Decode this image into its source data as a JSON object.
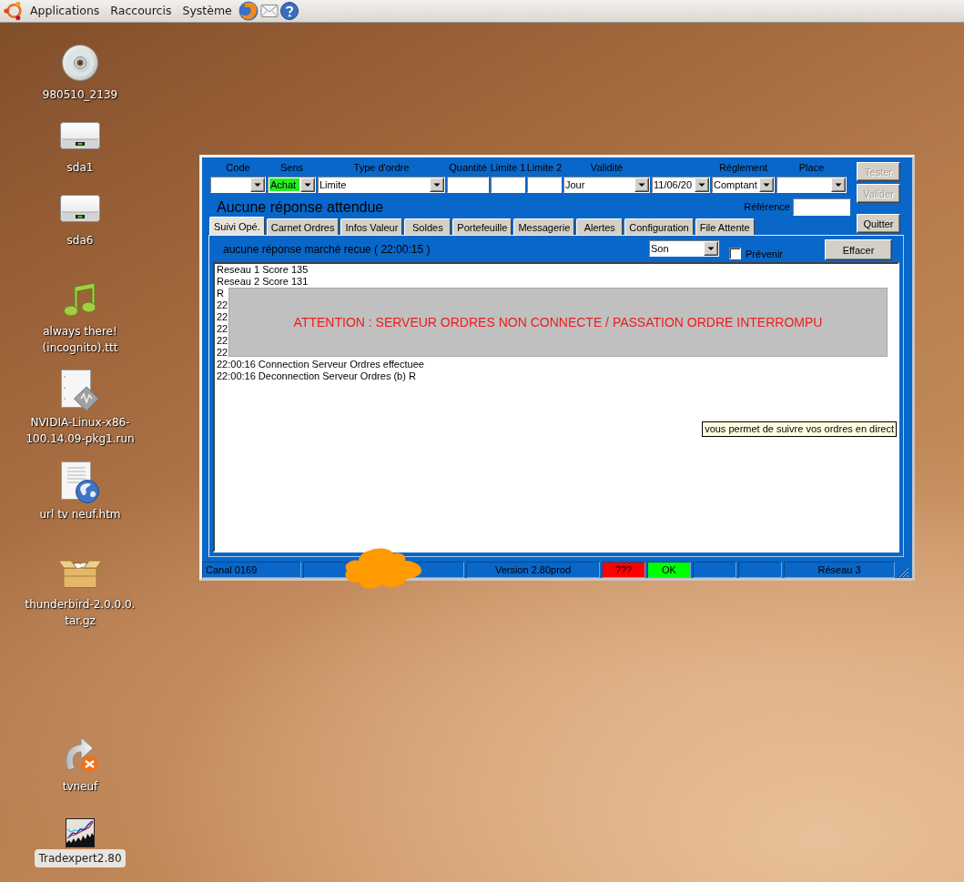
{
  "top_panel": {
    "menus": [
      {
        "label": "Applications"
      },
      {
        "label": "Raccourcis"
      },
      {
        "label": "Système"
      }
    ]
  },
  "desktop_icons": [
    {
      "kind": "disc",
      "label": "980510_2139",
      "selected": false
    },
    {
      "kind": "drive",
      "label": "sda1",
      "selected": false
    },
    {
      "kind": "drive",
      "label": "sda6",
      "selected": false
    },
    {
      "kind": "audio",
      "label": "always there!\n(incognito).ttt",
      "selected": false
    },
    {
      "kind": "binary",
      "label": "NVIDIA-Linux-x86-\n100.14.09-pkg1.run",
      "selected": false
    },
    {
      "kind": "web",
      "label": "url tv neuf.htm",
      "selected": false
    },
    {
      "kind": "archive",
      "label": "thunderbird-2.0.0.0.\ntar.gz",
      "selected": false
    },
    {
      "kind": "link",
      "label": "tvneuf",
      "selected": false
    },
    {
      "kind": "app",
      "label": "Tradexpert2.80",
      "selected": true
    }
  ],
  "window": {
    "order_form": [
      {
        "kind": "combo",
        "label": "Code",
        "highlighted": false
      },
      {
        "kind": "combo",
        "label": "Sens",
        "value": "Achat",
        "highlighted": true
      },
      {
        "kind": "combo",
        "label": "Type d'ordre",
        "value": "Limite",
        "highlighted": false
      },
      {
        "kind": "input",
        "label": "Quantité",
        "highlighted": false
      },
      {
        "kind": "input",
        "label": "Limite 1",
        "highlighted": false
      },
      {
        "kind": "input",
        "label": "Limite 2",
        "highlighted": false
      },
      {
        "kind": "combo",
        "label": "Validité",
        "value": "Jour",
        "highlighted": false
      },
      {
        "kind": "combo",
        "value": "11/06/20",
        "highlighted": false
      },
      {
        "kind": "combo",
        "label": "Réglement",
        "value": "Comptant",
        "highlighted": false
      },
      {
        "kind": "combo",
        "label": "Place",
        "highlighted": false
      }
    ],
    "buttons": [
      {
        "label": "Tester",
        "disabled": true
      },
      {
        "label": "Valider",
        "disabled": true
      },
      {
        "label": "Quitter",
        "disabled": false
      }
    ],
    "response_status": "Aucune réponse attendue",
    "reference": {
      "label": "Référence"
    },
    "tabs": [
      {
        "label": "Suivi Opé.",
        "selected": true
      },
      {
        "label": "Carnet Ordres",
        "selected": false
      },
      {
        "label": "Infos Valeur",
        "selected": false
      },
      {
        "label": "Soldes",
        "selected": false
      },
      {
        "label": "Portefeuille",
        "selected": false
      },
      {
        "label": "Messagerie",
        "selected": false
      },
      {
        "label": "Alertes",
        "selected": false
      },
      {
        "label": "Configuration",
        "selected": false
      },
      {
        "label": "File Attente",
        "selected": false
      }
    ],
    "panel": {
      "market_status": "aucune réponse marché recue ( 22:00:15 )",
      "sound_select": {
        "value": "Son"
      },
      "notify": {
        "label": "Prévenir",
        "checked": false
      },
      "clear_button": {
        "label": "Effacer"
      },
      "log": [
        "Reseau 1 Score 135",
        "Reseau 2 Score 131",
        "R",
        "22",
        "22",
        "22",
        "22",
        "22",
        "22:00:16 Connection Serveur Ordres effectuee",
        "22:00:16 Deconnection Serveur Ordres (b) R"
      ],
      "alert": "ATTENTION : SERVEUR ORDRES NON CONNECTE / PASSATION ORDRE INTERROMPU",
      "tooltip": "vous permet de suivre vos ordres en direct"
    },
    "status_bar": [
      {
        "kind": "text",
        "text": "Canal 0169"
      },
      {
        "kind": "empty"
      },
      {
        "kind": "text",
        "text": "Version 2.80prod"
      },
      {
        "kind": "indicator",
        "text": "???",
        "color": "#ff0000"
      },
      {
        "kind": "indicator",
        "text": "OK",
        "color": "#00ff00"
      },
      {
        "kind": "empty"
      },
      {
        "kind": "empty"
      },
      {
        "kind": "text",
        "text": "Réseau 3"
      }
    ]
  }
}
